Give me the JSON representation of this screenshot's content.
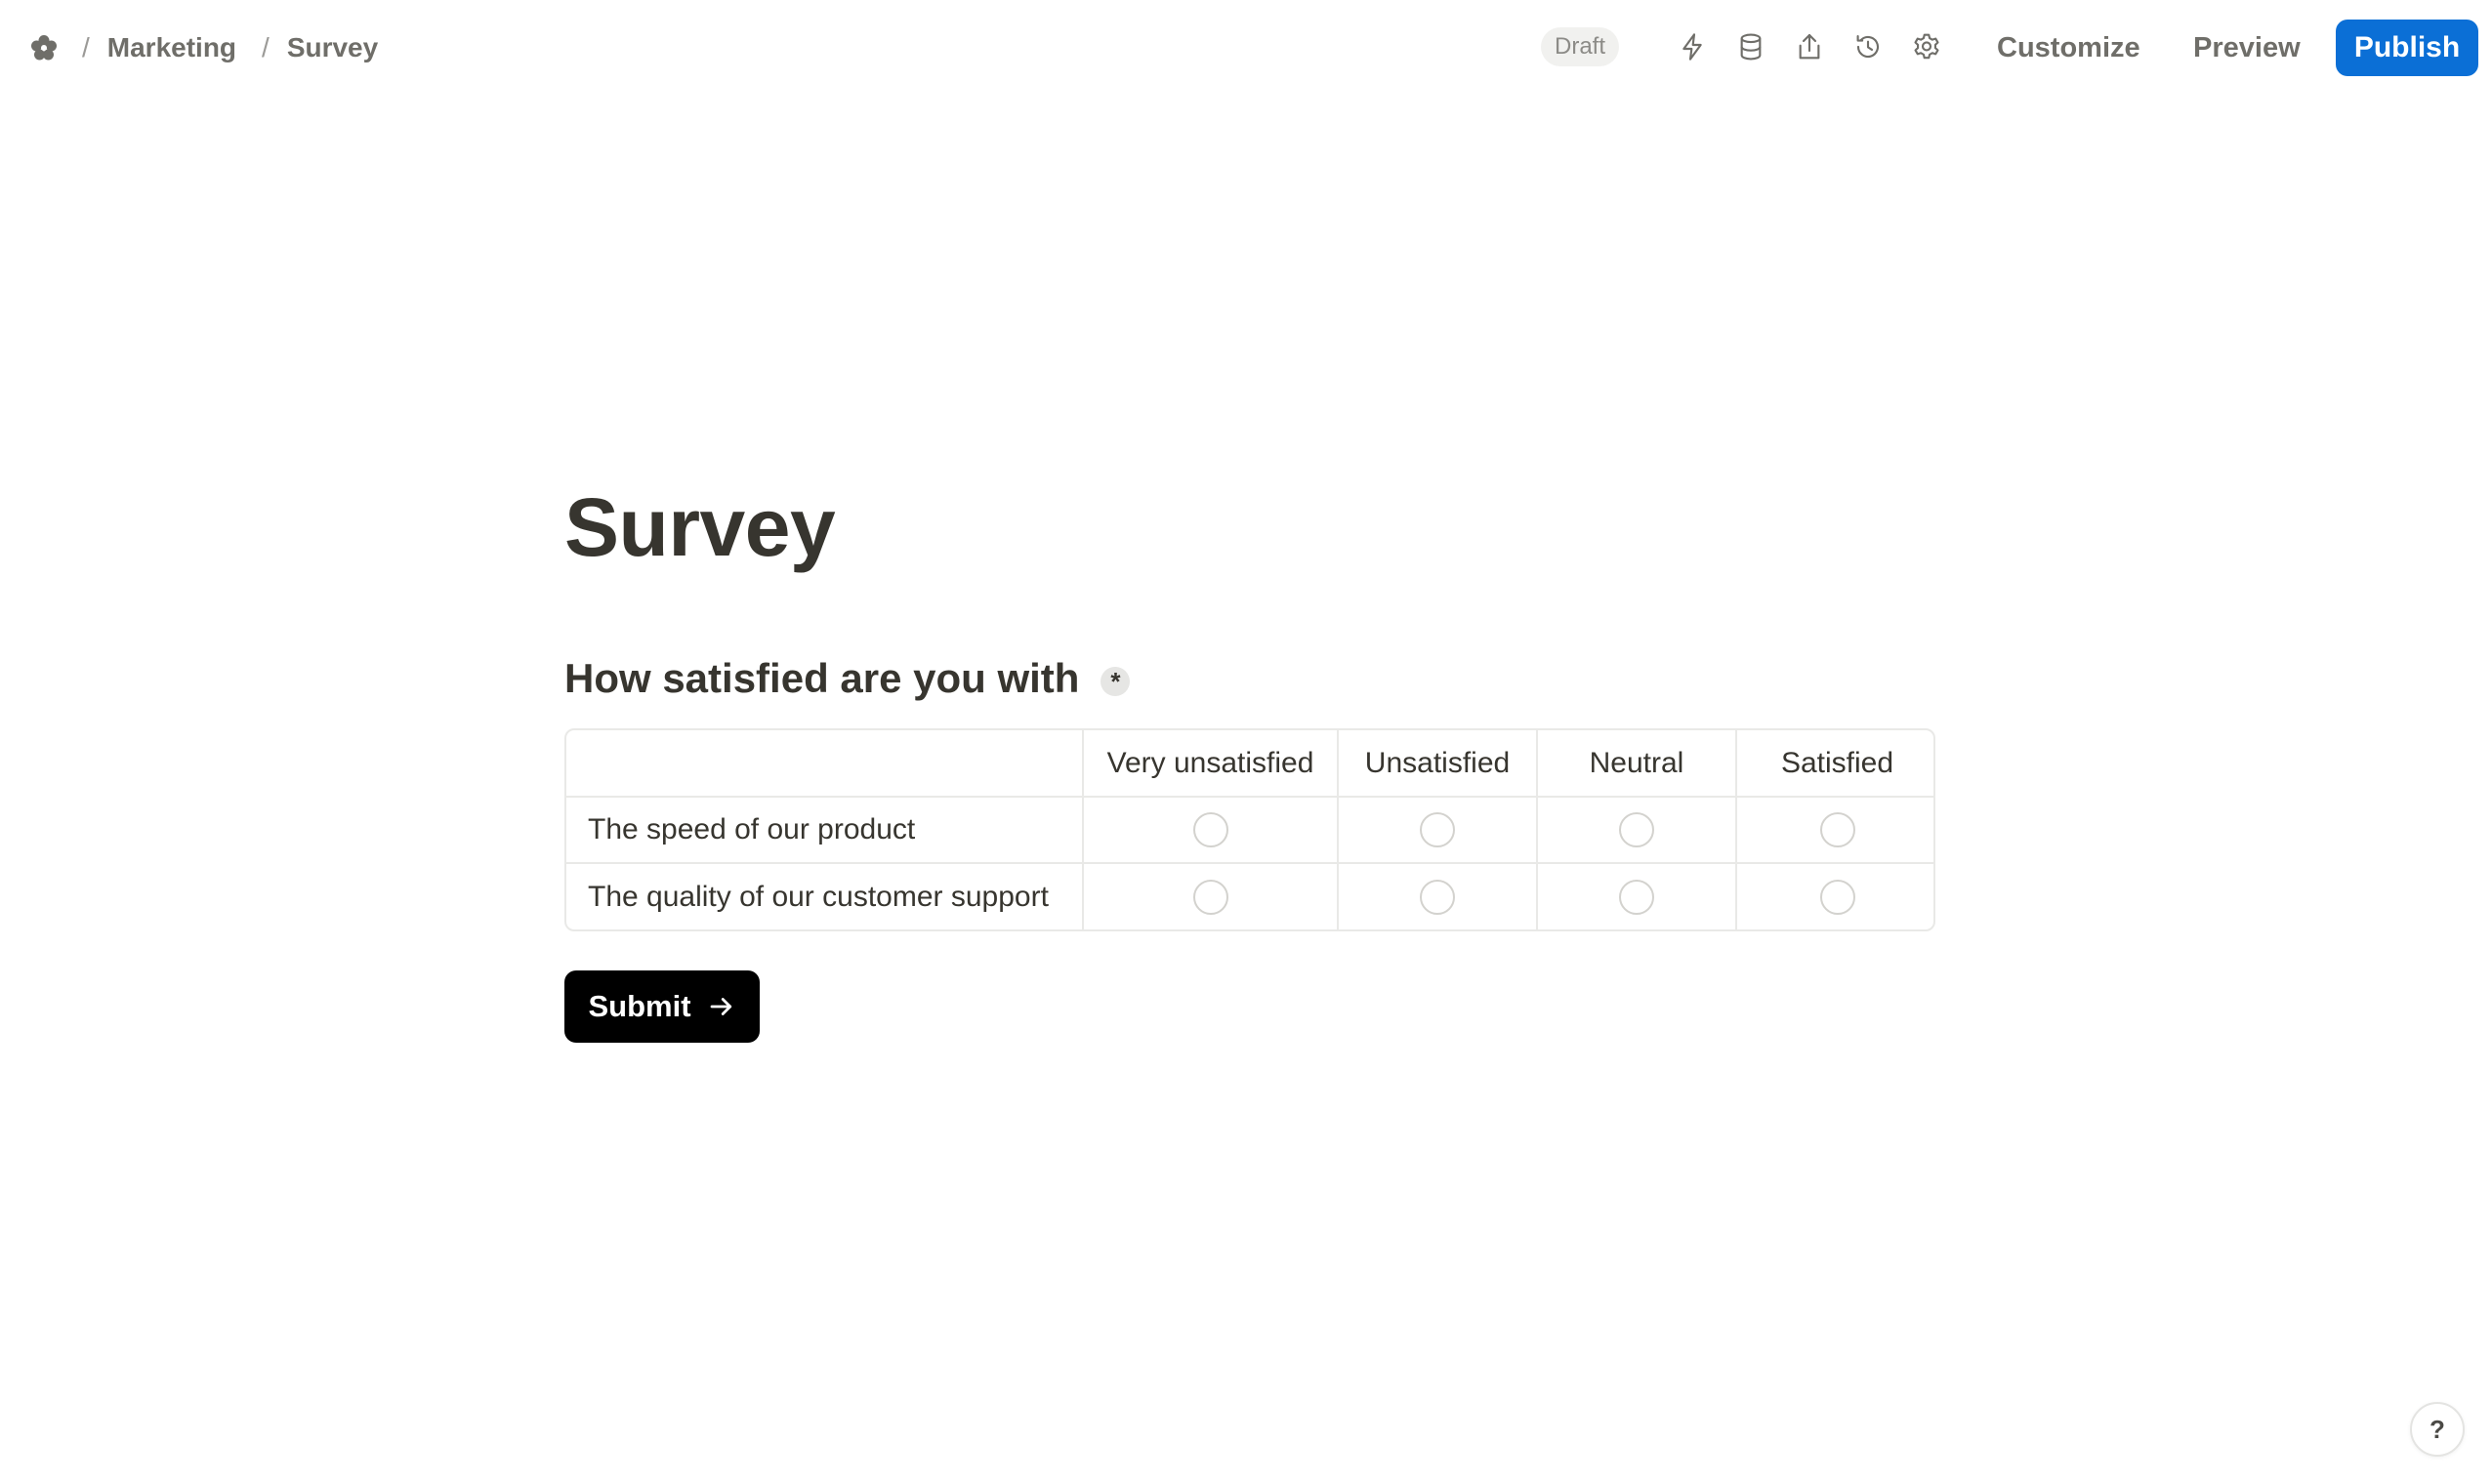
{
  "breadcrumb": {
    "logo_icon": "flower-logo-icon",
    "separator": "/",
    "items": [
      "Marketing",
      "Survey"
    ]
  },
  "toolbar": {
    "status_badge": "Draft",
    "icons": [
      "lightning-icon",
      "database-icon",
      "share-icon",
      "history-icon",
      "gear-icon"
    ],
    "customize_label": "Customize",
    "preview_label": "Preview",
    "publish_label": "Publish"
  },
  "form": {
    "title": "Survey",
    "question": {
      "label": "How satisfied are you with",
      "required_marker": "*",
      "columns": [
        "Very unsatisfied",
        "Unsatisfied",
        "Neutral",
        "Satisfied"
      ],
      "rows": [
        "The speed of our product",
        "The quality of our customer support"
      ]
    },
    "submit_label": "Submit"
  },
  "help": {
    "label": "?"
  },
  "colors": {
    "accent": "#0b6fd6",
    "text": "#37352f",
    "muted": "#6f6e69",
    "border": "#e9e9e7",
    "submit_bg": "#000000"
  }
}
